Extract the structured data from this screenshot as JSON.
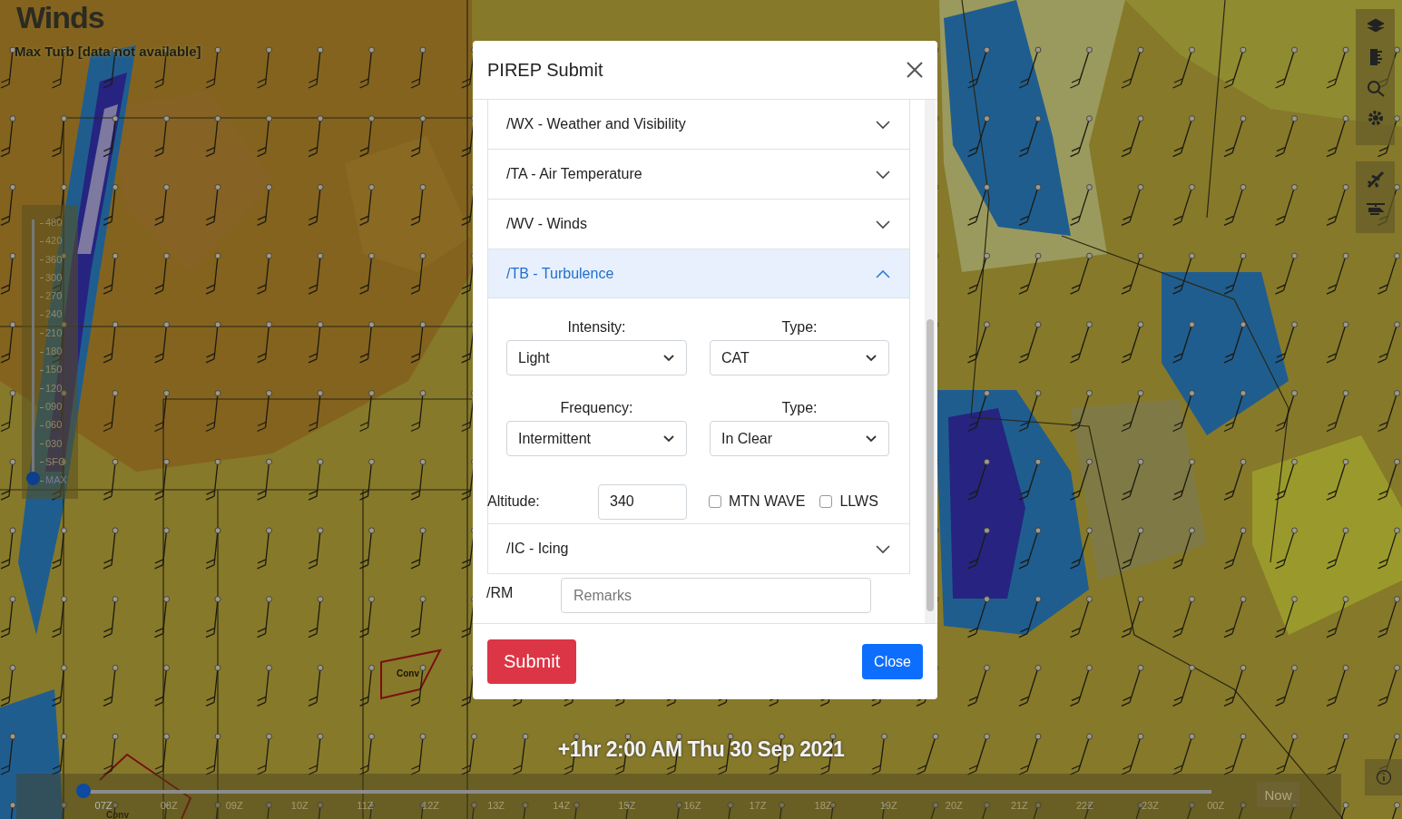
{
  "map": {
    "title": "Winds",
    "subtitle": "Max Turb [data not available]",
    "area_labels": [
      "Conv",
      "Conv"
    ]
  },
  "altitude_scale": [
    {
      "label": "480",
      "selected": false
    },
    {
      "label": "420",
      "selected": false
    },
    {
      "label": "360",
      "selected": false
    },
    {
      "label": "300",
      "selected": false
    },
    {
      "label": "270",
      "selected": false
    },
    {
      "label": "240",
      "selected": false
    },
    {
      "label": "210",
      "selected": false
    },
    {
      "label": "180",
      "selected": false
    },
    {
      "label": "150",
      "selected": false
    },
    {
      "label": "120",
      "selected": false
    },
    {
      "label": "090",
      "selected": false
    },
    {
      "label": "060",
      "selected": false
    },
    {
      "label": "030",
      "selected": false
    },
    {
      "label": "SFC",
      "selected": false
    },
    {
      "label": "MAX",
      "selected": true
    }
  ],
  "modal": {
    "title": "PIREP Submit",
    "sections": [
      {
        "label": "/WX - Weather and Visibility",
        "expanded": false
      },
      {
        "label": "/TA - Air Temperature",
        "expanded": false
      },
      {
        "label": "/WV - Winds",
        "expanded": false
      },
      {
        "label": "/TB - Turbulence",
        "expanded": true
      },
      {
        "label": "/IC - Icing",
        "expanded": false
      }
    ],
    "turbulence": {
      "selects": [
        {
          "label": "Intensity:",
          "value": "Light"
        },
        {
          "label": "Type:",
          "value": "CAT"
        },
        {
          "label": "Frequency:",
          "value": "Intermittent"
        },
        {
          "label": "Type:",
          "value": "In Clear"
        }
      ],
      "altitude": {
        "label": "Altitude:",
        "value": "340"
      },
      "checkboxes": [
        {
          "label": "MTN WAVE",
          "checked": false
        },
        {
          "label": "LLWS",
          "checked": false
        }
      ]
    },
    "remarks": {
      "label": "/RM",
      "placeholder": "Remarks"
    },
    "buttons": [
      {
        "label": "Submit",
        "kind": "danger"
      },
      {
        "label": "Close",
        "kind": "primary"
      }
    ]
  },
  "timeline": {
    "time": "+1hr 2:00 AM Thu 30 Sep 2021",
    "now": "Now",
    "hours": [
      {
        "label": "07Z",
        "selected": true
      },
      {
        "label": "08Z",
        "selected": false
      },
      {
        "label": "09Z",
        "selected": false
      },
      {
        "label": "10Z",
        "selected": false
      },
      {
        "label": "11Z",
        "selected": false
      },
      {
        "label": "12Z",
        "selected": false
      },
      {
        "label": "13Z",
        "selected": false
      },
      {
        "label": "14Z",
        "selected": false
      },
      {
        "label": "15Z",
        "selected": false
      },
      {
        "label": "16Z",
        "selected": false
      },
      {
        "label": "17Z",
        "selected": false
      },
      {
        "label": "18Z",
        "selected": false
      },
      {
        "label": "19Z",
        "selected": false
      },
      {
        "label": "20Z",
        "selected": false
      },
      {
        "label": "21Z",
        "selected": false
      },
      {
        "label": "22Z",
        "selected": false
      },
      {
        "label": "23Z",
        "selected": false
      },
      {
        "label": "00Z",
        "selected": false
      }
    ]
  }
}
